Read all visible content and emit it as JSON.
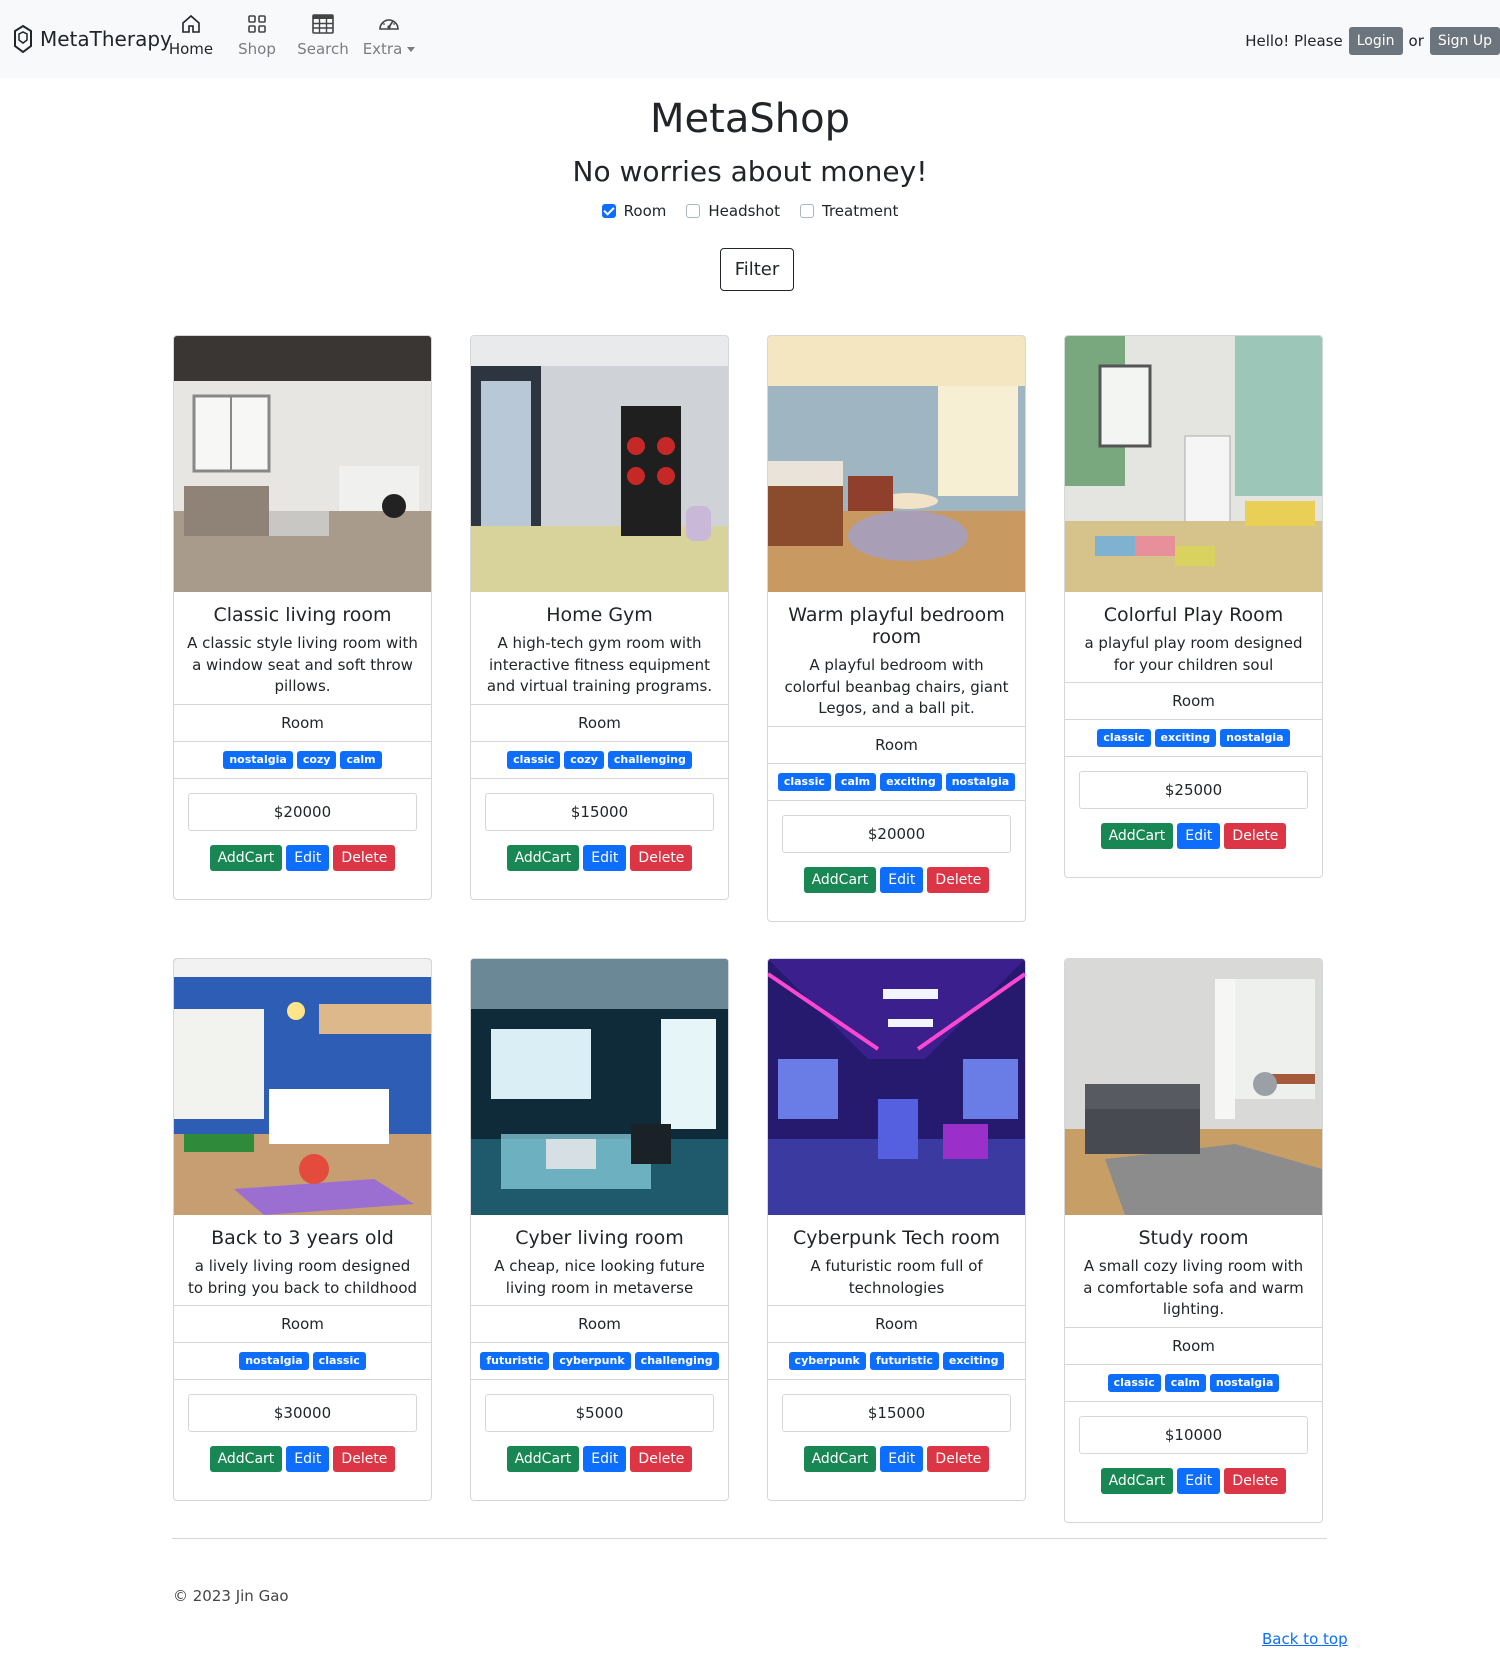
{
  "navbar": {
    "brand": "MetaTherapy",
    "items": [
      {
        "label": "Home",
        "icon": "home-icon",
        "active": true
      },
      {
        "label": "Shop",
        "icon": "grid-icon",
        "active": false
      },
      {
        "label": "Search",
        "icon": "table-icon",
        "active": false
      },
      {
        "label": "Extra",
        "icon": "speedometer-icon",
        "active": false,
        "dropdown": true
      }
    ],
    "greeting": "Hello! Please",
    "login": "Login",
    "or": "or",
    "signup": "Sign Up"
  },
  "page": {
    "title": "MetaShop",
    "subtitle": "No worries about money!"
  },
  "filters": {
    "options": [
      {
        "label": "Room",
        "checked": true
      },
      {
        "label": "Headshot",
        "checked": false
      },
      {
        "label": "Treatment",
        "checked": false
      }
    ],
    "button": "Filter"
  },
  "products": [
    {
      "title": "Classic living room",
      "desc": "A classic style living room with a window seat and soft throw pillows.",
      "category": "Room",
      "tags": [
        "nostalgia",
        "cozy",
        "calm"
      ],
      "price": "$20000",
      "image": "classic-living-room-image"
    },
    {
      "title": "Home Gym",
      "desc": "A high-tech gym room with interactive fitness equipment and virtual training programs.",
      "category": "Room",
      "tags": [
        "classic",
        "cozy",
        "challenging"
      ],
      "price": "$15000",
      "image": "home-gym-image"
    },
    {
      "title": "Warm playful bedroom room",
      "desc": "A playful bedroom with colorful beanbag chairs, giant Legos, and a ball pit.",
      "category": "Room",
      "tags": [
        "classic",
        "calm",
        "exciting",
        "nostalgia"
      ],
      "price": "$20000",
      "image": "warm-bedroom-image"
    },
    {
      "title": "Colorful Play Room",
      "desc": "a playful play room designed for your children soul",
      "category": "Room",
      "tags": [
        "classic",
        "exciting",
        "nostalgia"
      ],
      "price": "$25000",
      "image": "play-room-image"
    },
    {
      "title": "Back to 3 years old",
      "desc": "a lively living room designed to bring you back to childhood",
      "category": "Room",
      "tags": [
        "nostalgia",
        "classic"
      ],
      "price": "$30000",
      "image": "childhood-room-image"
    },
    {
      "title": "Cyber living room",
      "desc": "A cheap, nice looking future living room in metaverse",
      "category": "Room",
      "tags": [
        "futuristic",
        "cyberpunk",
        "challenging"
      ],
      "price": "$5000",
      "image": "cyber-living-room-image"
    },
    {
      "title": "Cyberpunk Tech room",
      "desc": "A futuristic room full of technologies",
      "category": "Room",
      "tags": [
        "cyberpunk",
        "futuristic",
        "exciting"
      ],
      "price": "$15000",
      "image": "cyberpunk-room-image"
    },
    {
      "title": "Study room",
      "desc": "A small cozy living room with a comfortable sofa and warm lighting.",
      "category": "Room",
      "tags": [
        "classic",
        "calm",
        "nostalgia"
      ],
      "price": "$10000",
      "image": "study-room-image"
    }
  ],
  "actions": {
    "add": "AddCart",
    "edit": "Edit",
    "delete": "Delete"
  },
  "footer": {
    "copyright": "© 2023 Jin Gao",
    "back_to_top": "Back to top"
  },
  "colors": {
    "primary": "#0d6efd",
    "success": "#198754",
    "danger": "#dc3545",
    "secondary": "#6c757d"
  }
}
